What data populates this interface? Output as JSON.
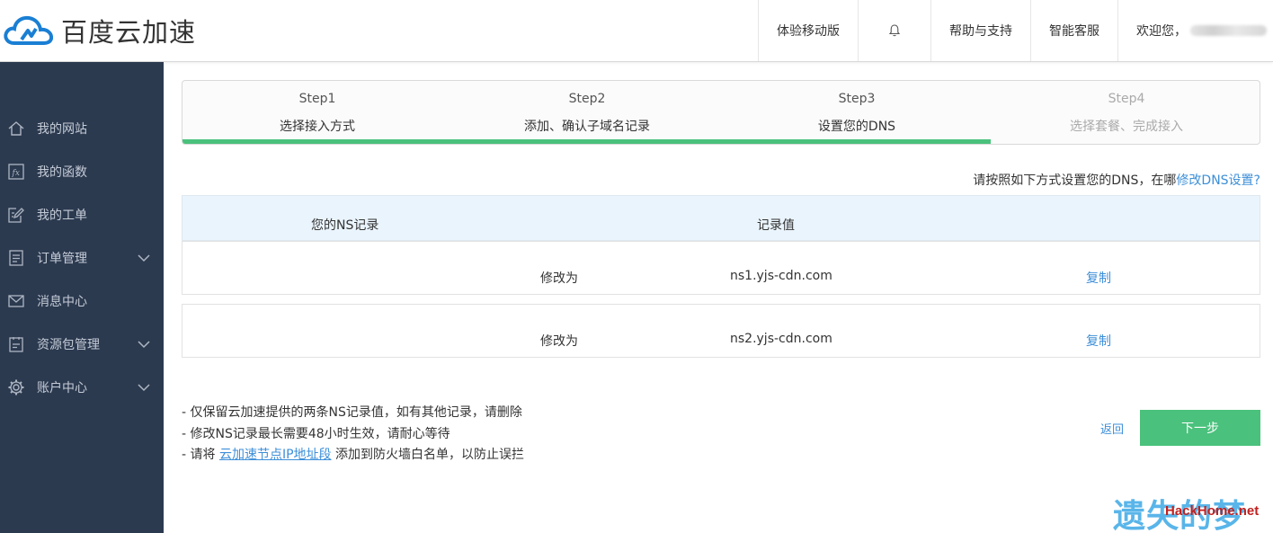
{
  "header": {
    "logo_text": "百度云加速",
    "nav": {
      "mobile": "体验移动版",
      "help": "帮助与支持",
      "service": "智能客服",
      "welcome": "欢迎您，"
    }
  },
  "sidebar": {
    "items": [
      {
        "label": "我的网站",
        "icon": "home-icon"
      },
      {
        "label": "我的函数",
        "icon": "function-icon"
      },
      {
        "label": "我的工单",
        "icon": "ticket-edit-icon"
      },
      {
        "label": "订单管理",
        "icon": "order-icon"
      },
      {
        "label": "消息中心",
        "icon": "mail-icon"
      },
      {
        "label": "资源包管理",
        "icon": "package-icon"
      },
      {
        "label": "账户中心",
        "icon": "gear-icon"
      }
    ]
  },
  "steps": [
    {
      "num": "Step1",
      "name": "选择接入方式"
    },
    {
      "num": "Step2",
      "name": "添加、确认子域名记录"
    },
    {
      "num": "Step3",
      "name": "设置您的DNS"
    },
    {
      "num": "Step4",
      "name": "选择套餐、完成接入"
    }
  ],
  "progress": {
    "completed_steps": 3,
    "total_steps": 4
  },
  "hint": {
    "text": "请按照如下方式设置您的DNS，在哪",
    "link": "修改DNS设置?"
  },
  "ns_table": {
    "headers": {
      "ns": "您的NS记录",
      "value": "记录值"
    },
    "rows": [
      {
        "action": "修改为",
        "value": "ns1.yjs-cdn.com",
        "copy": "复制"
      },
      {
        "action": "修改为",
        "value": "ns2.yjs-cdn.com",
        "copy": "复制"
      }
    ]
  },
  "notes": {
    "line1": "- 仅保留云加速提供的两条NS记录值，如有其他记录，请删除",
    "line2": "- 修改NS记录最长需要48小时生效，请耐心等待",
    "line3_prefix": "- 请将 ",
    "line3_link": "云加速节点IP地址段",
    "line3_suffix": " 添加到防火墙白名单，以防止误拦"
  },
  "actions": {
    "back": "返回",
    "next": "下一步"
  },
  "watermark": {
    "text": "遗失的梦",
    "sub": "HackHome.net"
  },
  "colors": {
    "accent_green": "#4ac17c",
    "link_blue": "#3d8fd8",
    "sidebar_bg": "#2c3a50",
    "table_head_bg": "#eaf4fc"
  }
}
